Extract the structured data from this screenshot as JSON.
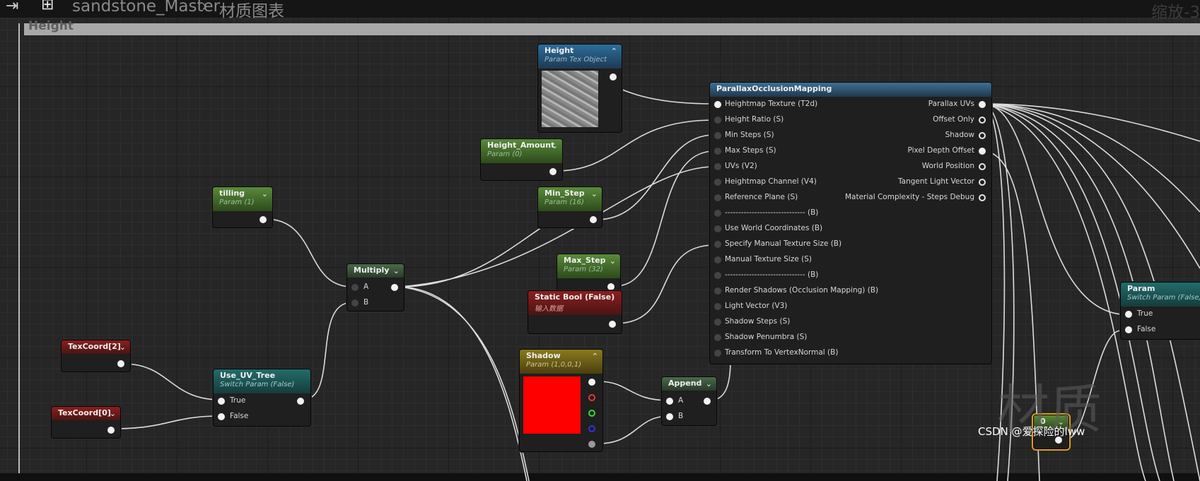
{
  "breadcrumb": {
    "asset": "sandstone_Master",
    "separator": "›",
    "graph": "材质图表"
  },
  "zoom_label": "缩放-3",
  "comment": {
    "title": "Height"
  },
  "nodes": {
    "height_tex": {
      "title": "Height",
      "subtitle": "Param Tex Object"
    },
    "height_amount": {
      "title": "Height_Amount",
      "subtitle": "Param (0)"
    },
    "tilling": {
      "title": "tilling",
      "subtitle": "Param (1)"
    },
    "min_step": {
      "title": "Min_Step",
      "subtitle": "Param (16)"
    },
    "max_step": {
      "title": "Max_Step",
      "subtitle": "Param (32)"
    },
    "static_bool": {
      "title": "Static Bool (False)",
      "subtitle": "输入数据"
    },
    "multiply": {
      "title": "Multiply",
      "pins": [
        "A",
        "B"
      ]
    },
    "texcoord2": {
      "title": "TexCoord[2]"
    },
    "texcoord0": {
      "title": "TexCoord[0]"
    },
    "use_uv_tree": {
      "title": "Use_UV_Tree",
      "subtitle": "Switch Param (False)",
      "pins": [
        "True",
        "False"
      ]
    },
    "shadow": {
      "title": "Shadow",
      "subtitle": "Param (1,0,0,1)"
    },
    "append": {
      "title": "Append",
      "pins": [
        "A",
        "B"
      ]
    },
    "pom": {
      "title": "ParallaxOcclusionMapping",
      "inputs": [
        "Heightmap Texture (T2d)",
        "Height Ratio (S)",
        "Min Steps (S)",
        "Max Steps (S)",
        "UVs (V2)",
        "Heightmap Channel (V4)",
        "Reference Plane (S)",
        "------------------------------ (B)",
        "Use World Coordinates (B)",
        "Specify Manual Texture Size (B)",
        "Manual Texture Size (S)",
        "------------------------------ (B)",
        "Render Shadows (Occlusion Mapping) (B)",
        "Light Vector (V3)",
        "Shadow Steps (S)",
        "Shadow Penumbra (S)",
        "Transform To VertexNormal (B)"
      ],
      "outputs": [
        "Parallax UVs",
        "Offset Only",
        "Shadow",
        "Pixel Depth Offset",
        "World Position",
        "Tangent Light Vector",
        "Material Complexity - Steps Debug"
      ]
    },
    "param_switch": {
      "title": "Param",
      "subtitle": "Switch Param (False)",
      "pins": [
        "True",
        "False"
      ]
    },
    "zero": {
      "title": "0"
    }
  },
  "watermark": "材质",
  "credit": "CSDN @爱探险的lww",
  "colors": {
    "graph_bg": "#262626",
    "header_green": "#5a8a3a",
    "header_blue": "#2c6e9c",
    "header_red": "#8b1f1f",
    "header_teal": "#236c6c",
    "header_gold": "#8a7a1c",
    "header_gray": "#4a6a4a",
    "shadow_swatch": "#ff0000",
    "selection": "#e39d13"
  }
}
